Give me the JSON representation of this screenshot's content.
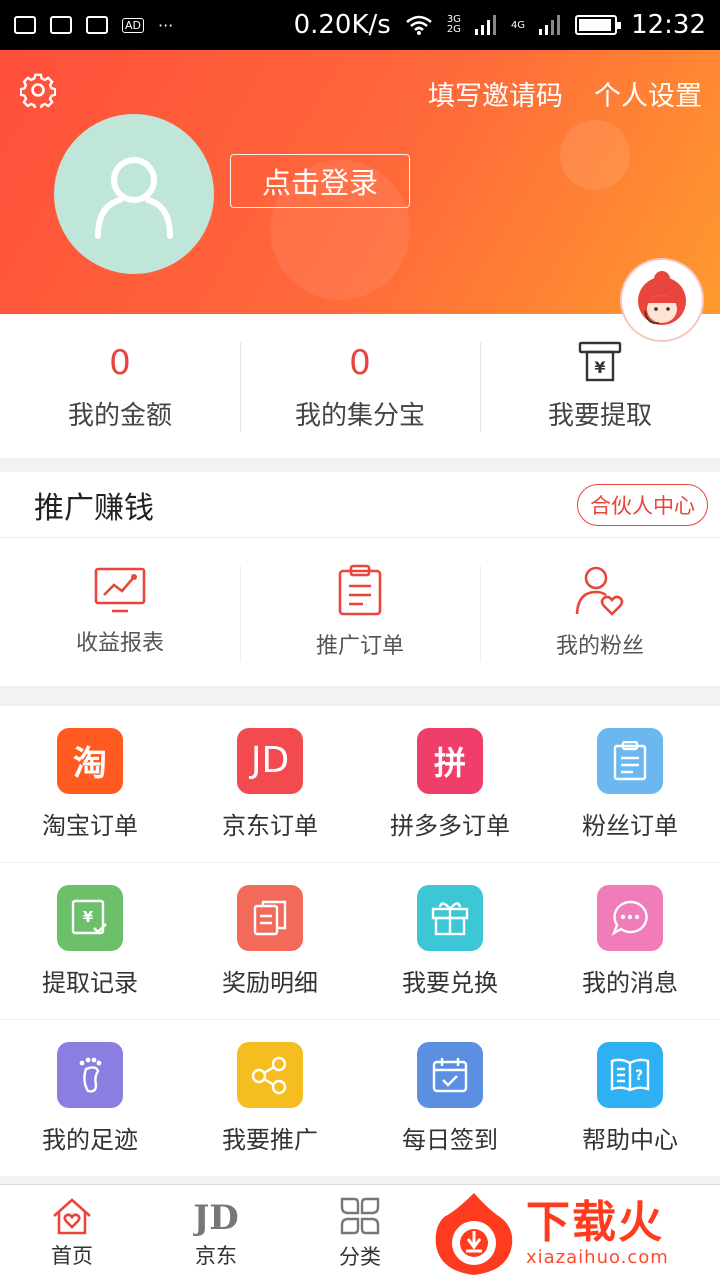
{
  "status_bar": {
    "speed": "0.20K/s",
    "net1": "3G",
    "net2": "2G",
    "net3": "4G",
    "ad": "AD",
    "more": "···",
    "time": "12:32"
  },
  "header": {
    "invite_label": "填写邀请码",
    "settings_label": "个人设置",
    "login_label": "点击登录"
  },
  "stats": [
    {
      "value": "0",
      "label": "我的金额"
    },
    {
      "value": "0",
      "label": "我的集分宝"
    },
    {
      "value": "",
      "label": "我要提取"
    }
  ],
  "promo": {
    "title": "推广赚钱",
    "partner_label": "合伙人中心",
    "items": [
      {
        "label": "收益报表"
      },
      {
        "label": "推广订单"
      },
      {
        "label": "我的粉丝"
      }
    ]
  },
  "grid": [
    {
      "label": "淘宝订单",
      "glyph": "淘",
      "color": "#ff5a1f"
    },
    {
      "label": "京东订单",
      "glyph": "JD",
      "color": "#f24a4f"
    },
    {
      "label": "拼多多订单",
      "glyph": "拼",
      "color": "#f03e6a"
    },
    {
      "label": "粉丝订单",
      "glyph": "",
      "color": "#6ab8ef"
    },
    {
      "label": "提取记录",
      "glyph": "",
      "color": "#6cc06a"
    },
    {
      "label": "奖励明细",
      "glyph": "",
      "color": "#f26a5a"
    },
    {
      "label": "我要兑换",
      "glyph": "",
      "color": "#3dc7d6"
    },
    {
      "label": "我的消息",
      "glyph": "",
      "color": "#f07cb8"
    },
    {
      "label": "我的足迹",
      "glyph": "",
      "color": "#8a7fe0"
    },
    {
      "label": "我要推广",
      "glyph": "",
      "color": "#f5bd1f"
    },
    {
      "label": "每日签到",
      "glyph": "",
      "color": "#5b8fe2"
    },
    {
      "label": "帮助中心",
      "glyph": "",
      "color": "#2fb0f2"
    }
  ],
  "bottom_nav": [
    {
      "label": "首页",
      "icon": "home-icon"
    },
    {
      "label": "京东",
      "icon": "jd-icon"
    },
    {
      "label": "分类",
      "icon": "category-icon"
    }
  ],
  "watermark": {
    "text": "下载火",
    "url_text": "xiazaihuo.com"
  },
  "colors": {
    "accent": "#e8463c",
    "header_start": "#ff4f3b",
    "header_end": "#ff9a2e"
  }
}
